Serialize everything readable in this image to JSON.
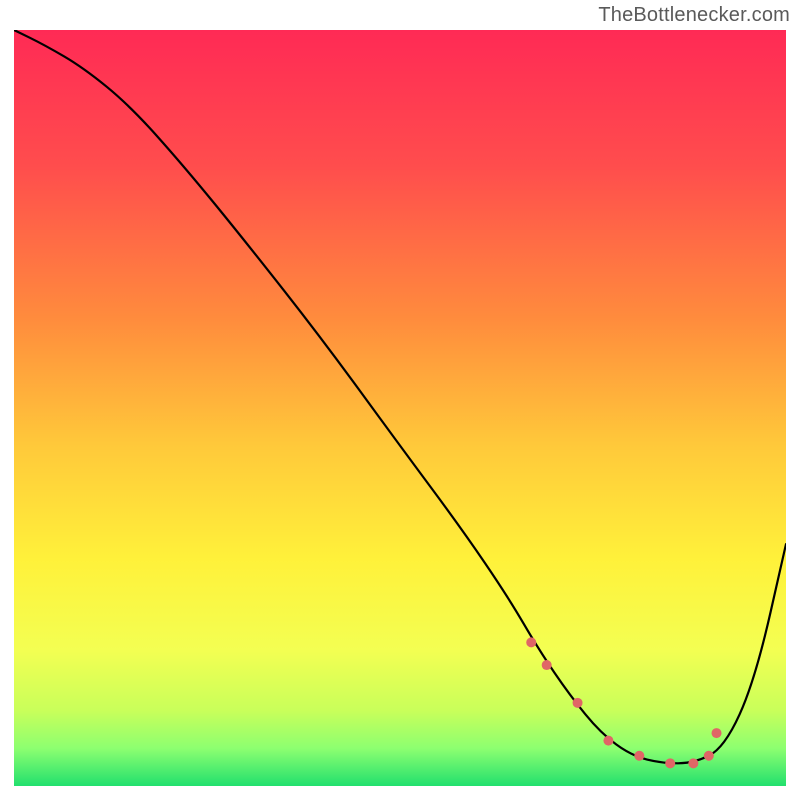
{
  "attribution": "TheBottlenecker.com",
  "chart_data": {
    "type": "line",
    "title": "",
    "xlabel": "",
    "ylabel": "",
    "xlim": [
      0,
      100
    ],
    "ylim": [
      0,
      100
    ],
    "background": {
      "gradient_stops": [
        {
          "offset": 0,
          "color": "#ff2a55"
        },
        {
          "offset": 18,
          "color": "#ff4d4d"
        },
        {
          "offset": 38,
          "color": "#ff8b3d"
        },
        {
          "offset": 55,
          "color": "#ffc93a"
        },
        {
          "offset": 70,
          "color": "#fff13a"
        },
        {
          "offset": 82,
          "color": "#f3ff52"
        },
        {
          "offset": 90,
          "color": "#c9ff5a"
        },
        {
          "offset": 95,
          "color": "#8dff70"
        },
        {
          "offset": 100,
          "color": "#22e06e"
        }
      ]
    },
    "series": [
      {
        "name": "bottleneck-curve",
        "stroke": "#000000",
        "stroke_width": 2.2,
        "x": [
          0,
          4,
          9,
          15,
          22,
          30,
          40,
          50,
          58,
          64,
          68,
          72,
          76,
          80,
          84,
          88,
          92,
          96,
          100
        ],
        "y": [
          100,
          98,
          95,
          90,
          82,
          72,
          59,
          45,
          34,
          25,
          18,
          12,
          7,
          4,
          3,
          3,
          5,
          14,
          32
        ]
      }
    ],
    "markers": {
      "name": "sweet-spot",
      "color": "#e06666",
      "radius_px": 5,
      "x": [
        67,
        69,
        73,
        77,
        81,
        85,
        88,
        90,
        91
      ],
      "y": [
        19,
        16,
        11,
        6,
        4,
        3,
        3,
        4,
        7
      ]
    }
  }
}
